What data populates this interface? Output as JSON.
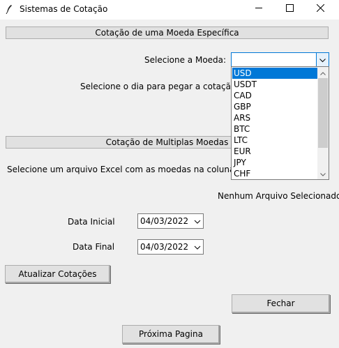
{
  "window": {
    "title": "Sistemas de Cotação",
    "icon": "feather-icon"
  },
  "single_currency": {
    "section_title": "Cotação de uma Moeda Específica",
    "select_currency_label": "Selecione a Moeda:",
    "select_day_label": "Selecione o dia para pegar a cotação:",
    "currency_value": "",
    "options": [
      "USD",
      "USDT",
      "CAD",
      "GBP",
      "ARS",
      "BTC",
      "LTC",
      "EUR",
      "JPY",
      "CHF"
    ],
    "highlighted_option": "USD"
  },
  "multi_currency": {
    "section_title": "Cotação de Multiplas Moedas",
    "file_prompt": "Selecione um arquivo Excel com as moedas na coluna A:",
    "file_status": "Nenhum Arquivo Selecionado",
    "start_date_label": "Data Inicial",
    "start_date_value": "04/03/2022",
    "end_date_label": "Data Final",
    "end_date_value": "04/03/2022",
    "update_button": "Atualizar Cotações"
  },
  "footer": {
    "close_button": "Fechar",
    "next_page_button": "Próxima Pagina"
  },
  "colors": {
    "selection": "#0078d7",
    "window_bg": "#f0f0f0",
    "button_bg": "#e1e1e1"
  }
}
